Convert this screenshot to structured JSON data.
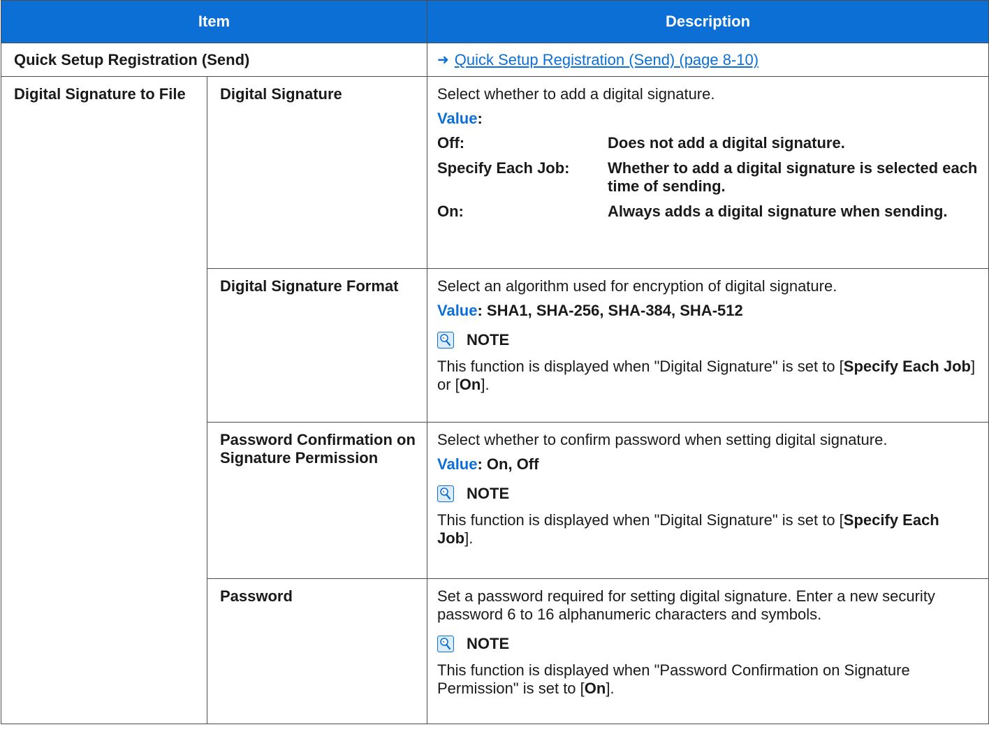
{
  "header": {
    "item": "Item",
    "description": "Description"
  },
  "rows": {
    "quick_setup": {
      "item": "Quick Setup Registration (Send)",
      "link": "Quick Setup Registration (Send) (page 8-10)"
    },
    "group_label": "Digital Signature to File",
    "digital_signature": {
      "item": "Digital Signature",
      "desc": "Select whether to add a digital signature.",
      "value_label": "Value",
      "values": [
        {
          "key": "Off:",
          "text": "Does not add a digital signature."
        },
        {
          "key": "Specify Each Job:",
          "text": "Whether to add a digital signature is selected each time of sending."
        },
        {
          "key": "On:",
          "text": "Always adds a digital signature when sending."
        }
      ]
    },
    "format": {
      "item": "Digital Signature Format",
      "desc": "Select an algorithm used for encryption of digital signature.",
      "value_label": "Value",
      "value_text": ": SHA1, SHA-256, SHA-384, SHA-512",
      "note_label": "NOTE",
      "note_pre": "This function is displayed when \"Digital Signature\" is set to [",
      "note_b1": "Specify Each Job",
      "note_mid": "] or [",
      "note_b2": "On",
      "note_post": "]."
    },
    "pw_confirm": {
      "item": "Password Confirmation on Signature Permission",
      "desc": "Select whether to confirm password when setting digital signature.",
      "value_label": "Value",
      "value_text": ": On, Off",
      "note_label": "NOTE",
      "note_pre": "This function is displayed when \"Digital Signature\" is set to [",
      "note_b1": "Specify Each Job",
      "note_post": "]."
    },
    "password": {
      "item": "Password",
      "desc": "Set a password required for setting digital signature. Enter a new security password 6 to 16 alphanumeric characters and symbols.",
      "note_label": "NOTE",
      "note_pre": "This function is displayed when \"Password Confirmation on Signature Permission\" is set to [",
      "note_b1": "On",
      "note_post": "]."
    }
  },
  "colors": {
    "header_bg": "#0b6fd6",
    "accent": "#0b6fd6",
    "border": "#4d4d4d"
  },
  "icons": {
    "link_arrow": "arrow-right-icon",
    "note": "note-lightbulb-icon"
  }
}
